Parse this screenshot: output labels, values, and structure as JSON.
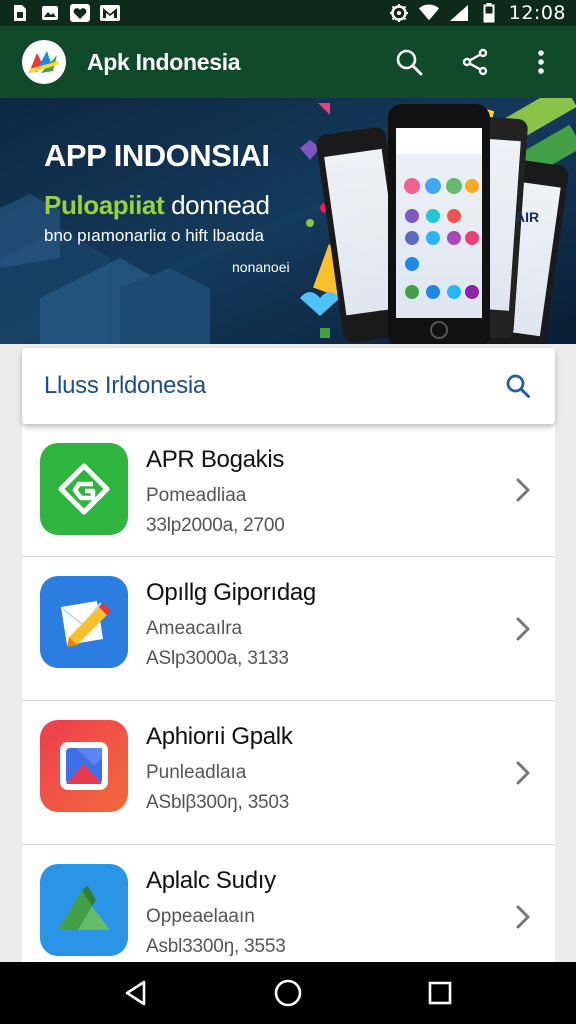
{
  "status_bar": {
    "time": "12:08",
    "left_icons": [
      "sim-card-icon",
      "image-icon",
      "heart-icon",
      "gmail-icon"
    ],
    "right_icons": [
      "alarm-icon",
      "wifi-icon",
      "signal-icon",
      "battery-icon"
    ]
  },
  "app_bar": {
    "title": "Apk Indonesia",
    "logo_icon": "apk-indonesia-logo",
    "actions": [
      {
        "name": "search",
        "icon": "search-icon"
      },
      {
        "name": "share",
        "icon": "share-icon"
      },
      {
        "name": "more",
        "icon": "more-vert-icon"
      }
    ]
  },
  "banner": {
    "title": "APP INDONSIAI",
    "subtitle_green": "Puloapiiat",
    "subtitle_white": "donnead",
    "description": "bno pıamonarliα o hift lbaαda",
    "tag": "nonanoei"
  },
  "search_card": {
    "title": "Lluss Irldonesia",
    "icon": "search-icon"
  },
  "apps": [
    {
      "name": "APR Bogakis",
      "category": "Pomeadliaa",
      "meta": "33lp2000a, 2700",
      "icon": "g-arrow-icon",
      "color": "#2fb53f"
    },
    {
      "name": "Opıllg Giporıdag",
      "category": "Ameacaılra",
      "meta": "ASlp3000a, 3133",
      "icon": "paper-pencil-icon",
      "color": "#2b7de0"
    },
    {
      "name": "Aphiorıi Gpalk",
      "category": "Punleadlaıa",
      "meta": "ASblβ300ŋ, 3503",
      "icon": "photo-frame-icon",
      "color": "#ef3e52"
    },
    {
      "name": "Aplalc Sudıy",
      "category": "Oppeaelaaın",
      "meta": "Asbl3300ŋ, 3553",
      "icon": "green-a-icon",
      "color": "#2a95e6"
    }
  ],
  "nav_bar": {
    "buttons": [
      "back-icon",
      "home-icon",
      "recents-icon"
    ]
  }
}
